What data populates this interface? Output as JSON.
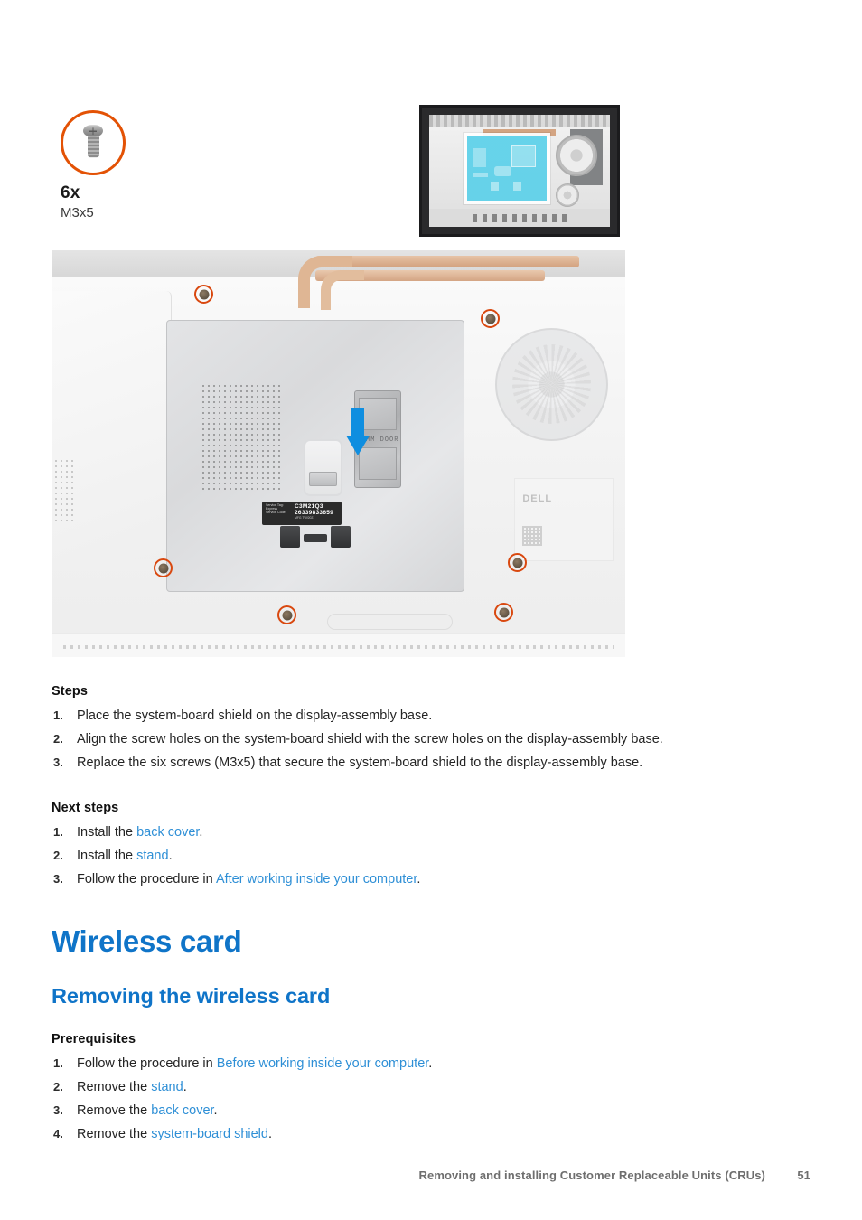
{
  "callout": {
    "icon": "screw-icon",
    "count": "6x",
    "size": "M3x5"
  },
  "locator": {
    "label": "system-board-shield-location-thumbnail",
    "highlight_color": "#3fc9e6"
  },
  "photo": {
    "label": "system-board-shield-installation-photo",
    "dimm_door_label": "DIMM DOOR",
    "service_label": {
      "key_service_tag": "Service Tag:",
      "key_express": "Express",
      "key_service_code": "Service Code:",
      "service_tag": "C3M21Q3",
      "express_service_code": "26339833659",
      "sub": "MFG TW/2021"
    },
    "brand_label": "DELL",
    "screw_mark_color": "#D9480F",
    "arrow_color": "#0F8EE0"
  },
  "steps": {
    "heading": "Steps",
    "items": [
      "Place the system-board shield on the display-assembly base.",
      "Align the screw holes on the system-board shield with the screw holes on the display-assembly base.",
      "Replace the six screws (M3x5) that secure the system-board shield to the display-assembly base."
    ]
  },
  "next_steps": {
    "heading": "Next steps",
    "items": [
      {
        "pre": "Install the ",
        "link": "back cover",
        "post": "."
      },
      {
        "pre": "Install the ",
        "link": "stand",
        "post": "."
      },
      {
        "pre": "Follow the procedure in ",
        "link": "After working inside your computer",
        "post": "."
      }
    ]
  },
  "chapter_title": "Wireless card",
  "section_title": "Removing the wireless card",
  "prerequisites": {
    "heading": "Prerequisites",
    "items": [
      {
        "pre": "Follow the procedure in ",
        "link": "Before working inside your computer",
        "post": "."
      },
      {
        "pre": "Remove the ",
        "link": "stand",
        "post": "."
      },
      {
        "pre": "Remove the ",
        "link": "back cover",
        "post": "."
      },
      {
        "pre": "Remove the ",
        "link": "system-board shield",
        "post": "."
      }
    ]
  },
  "footer": {
    "text": "Removing and installing Customer Replaceable Units (CRUs)",
    "page": "51"
  },
  "colors": {
    "heading_blue": "#0F74C8",
    "link_blue": "#2e8fd6",
    "accent_orange": "#E35205"
  }
}
